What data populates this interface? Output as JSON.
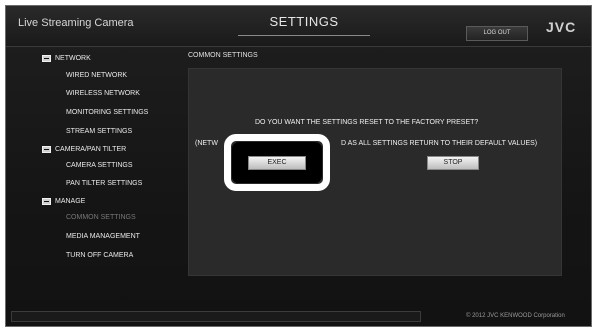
{
  "header": {
    "app_title": "Live Streaming Camera",
    "page_title": "SETTINGS",
    "logout_label": "LOG OUT",
    "logo": "JVC"
  },
  "sidebar": {
    "sections": [
      {
        "label": "NETWORK",
        "items": [
          "WIRED NETWORK",
          "WIRELESS NETWORK",
          "MONITORING SETTINGS",
          "STREAM SETTINGS"
        ]
      },
      {
        "label": "CAMERA/PAN TILTER",
        "items": [
          "CAMERA SETTINGS",
          "PAN TILTER SETTINGS"
        ]
      },
      {
        "label": "MANAGE",
        "items": [
          "COMMON SETTINGS",
          "MEDIA MANAGEMENT",
          "TURN OFF CAMERA"
        ]
      }
    ],
    "active_item": "COMMON SETTINGS"
  },
  "main": {
    "section_title": "COMMON SETTINGS",
    "question": "DO YOU WANT THE SETTINGS RESET TO THE FACTORY PRESET?",
    "note_left": "(NETW",
    "note_right": "D AS ALL SETTINGS RETURN TO THEIR DEFAULT VALUES)",
    "exec_label": "EXEC",
    "stop_label": "STOP"
  },
  "footer": {
    "copyright": "© 2012 JVC KENWOOD Corporation"
  }
}
